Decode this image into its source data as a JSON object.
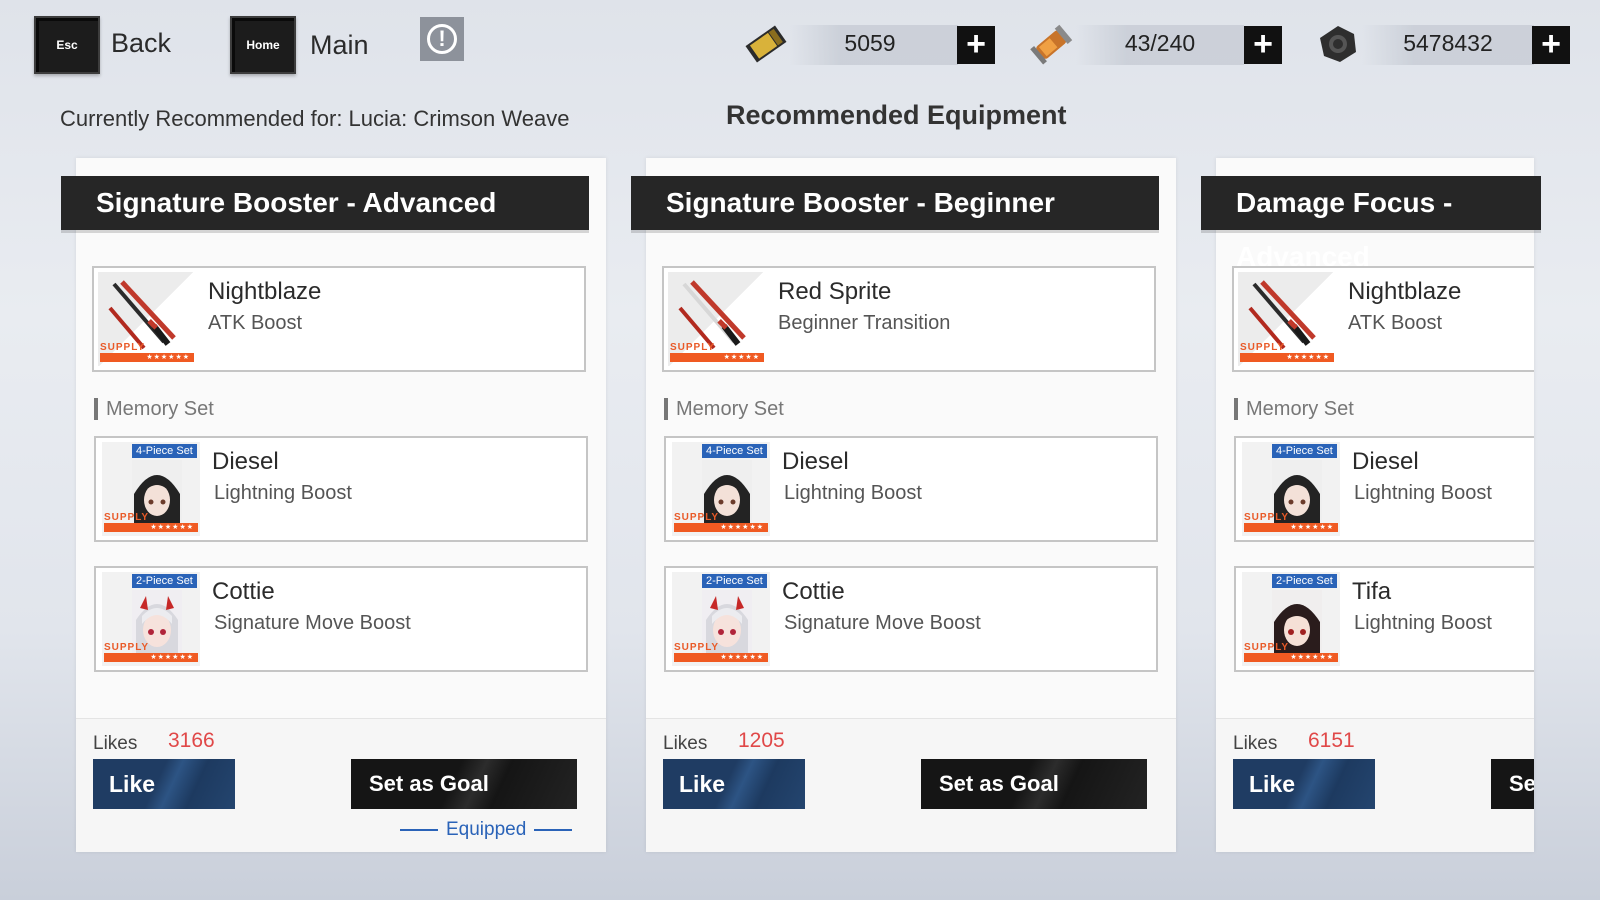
{
  "topbar": {
    "back": {
      "key": "Esc",
      "label": "Back"
    },
    "home": {
      "key": "Home",
      "label": "Main"
    },
    "info_glyph": "!",
    "resources": [
      {
        "icon": "gold-ticket-icon",
        "value": "5059"
      },
      {
        "icon": "serum-canister-icon",
        "value": "43/240"
      },
      {
        "icon": "cog-coin-icon",
        "value": "5478432"
      }
    ],
    "plus_glyph": "+"
  },
  "recommended_for": "Currently Recommended for: Lucia: Crimson Weave",
  "page_title": "Recommended Equipment",
  "memory_section_label": "Memory Set",
  "supply_label": "SUPPLY",
  "rarity_stars": "★★★★★★",
  "likes_label": "Likes",
  "like_label": "Like",
  "goal_label": "Set as Goal",
  "equipped_label": "Equipped",
  "cards": [
    {
      "title": "Signature Booster - Advanced",
      "weapon": {
        "name": "Nightblaze",
        "effect": "ATK Boost",
        "stars": "★★★★★★"
      },
      "memories": [
        {
          "set": "4-Piece Set",
          "name": "Diesel",
          "effect": "Lightning Boost"
        },
        {
          "set": "2-Piece Set",
          "name": "Cottie",
          "effect": "Signature Move Boost"
        }
      ],
      "likes": "3166",
      "equipped": true
    },
    {
      "title": "Signature Booster - Beginner",
      "weapon": {
        "name": "Red Sprite",
        "effect": "Beginner Transition",
        "stars": "★★★★★"
      },
      "memories": [
        {
          "set": "4-Piece Set",
          "name": "Diesel",
          "effect": "Lightning Boost"
        },
        {
          "set": "2-Piece Set",
          "name": "Cottie",
          "effect": "Signature Move Boost"
        }
      ],
      "likes": "1205",
      "equipped": false
    },
    {
      "title": "Damage Focus - Advanced",
      "weapon": {
        "name": "Nightblaze",
        "effect": "ATK Boost",
        "stars": "★★★★★★"
      },
      "memories": [
        {
          "set": "4-Piece Set",
          "name": "Diesel",
          "effect": "Lightning Boost"
        },
        {
          "set": "2-Piece Set",
          "name": "Tifa",
          "effect": "Lightning Boost"
        }
      ],
      "likes": "6151",
      "equipped": false
    }
  ],
  "colors": {
    "accent_blue": "#2a63b8",
    "likes_red": "#e04848",
    "rarity_orange": "#f05a22"
  }
}
